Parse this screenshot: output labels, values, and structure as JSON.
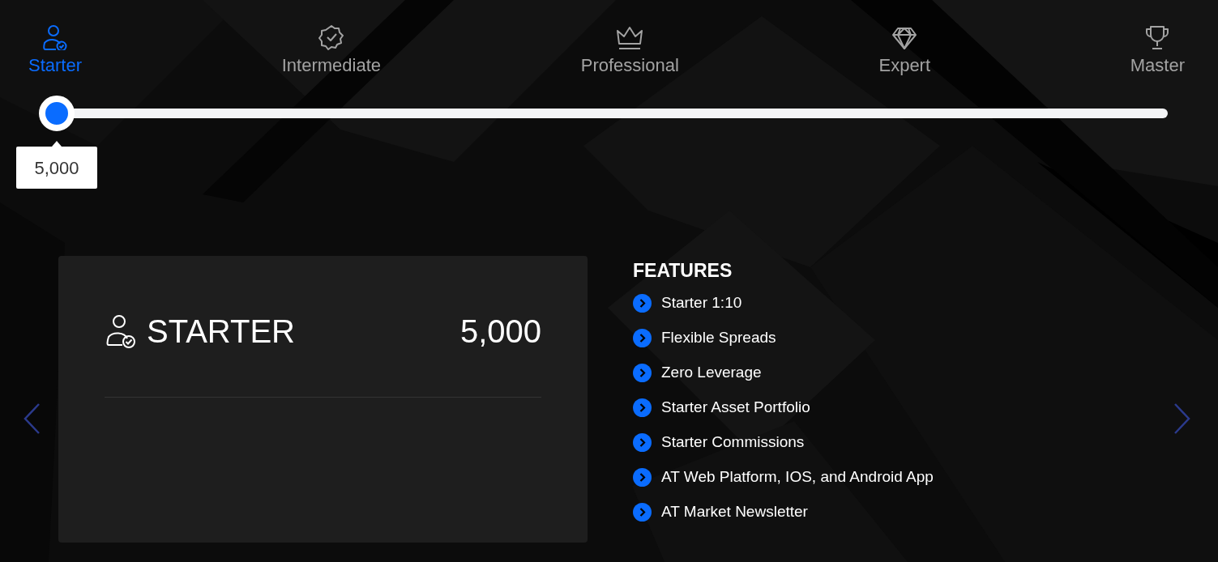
{
  "tabs": [
    {
      "label": "Starter",
      "selected": true
    },
    {
      "label": "Intermediate",
      "selected": false
    },
    {
      "label": "Professional",
      "selected": false
    },
    {
      "label": "Expert",
      "selected": false
    },
    {
      "label": "Master",
      "selected": false
    }
  ],
  "slider": {
    "level": 0,
    "tooltip": "5,000"
  },
  "plan_card": {
    "title": "STARTER",
    "amount": "5,000"
  },
  "features": {
    "title": "FEATURES",
    "items": [
      "Starter 1:10",
      "Flexible Spreads",
      "Zero Leverage",
      "Starter Asset Portfolio",
      "Starter Commissions",
      "AT Web Platform, IOS, and Android App",
      "AT Market Newsletter"
    ]
  }
}
